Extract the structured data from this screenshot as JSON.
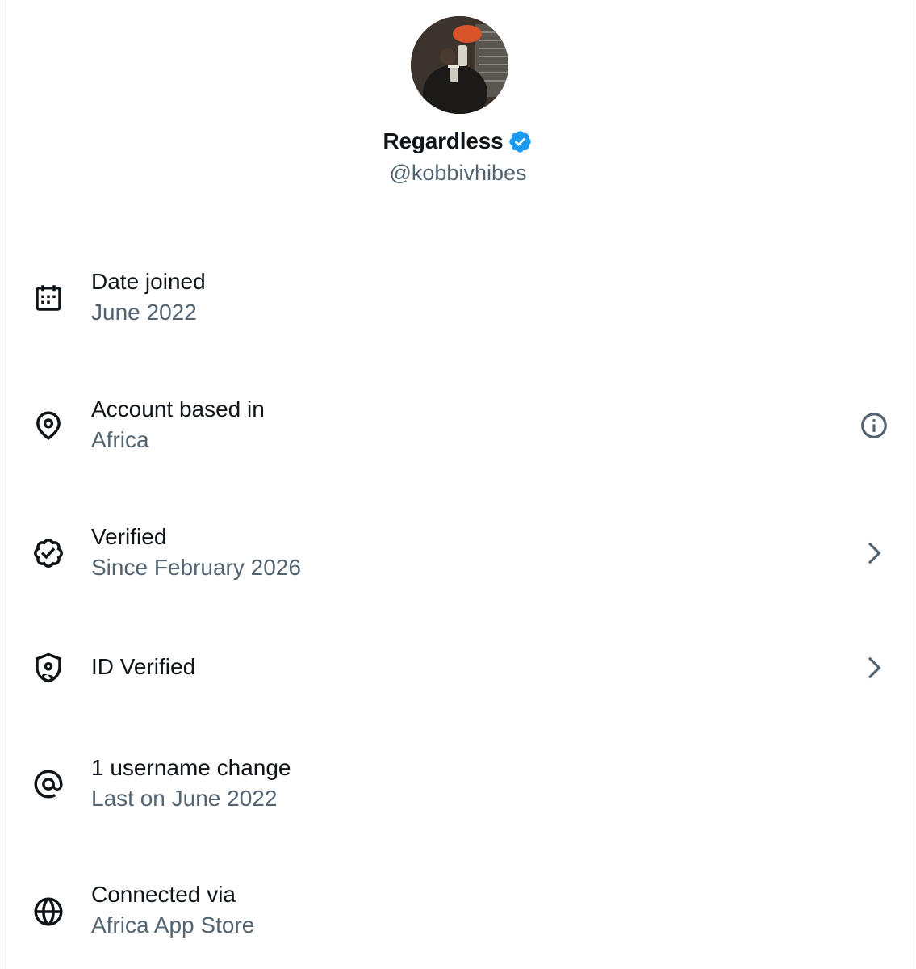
{
  "profile": {
    "display_name": "Regardless",
    "handle": "@kobbivhibes",
    "verified_color": "#1d9bf0"
  },
  "rows": [
    {
      "icon": "calendar-icon",
      "title": "Date joined",
      "value": "June 2022",
      "trailing": null
    },
    {
      "icon": "location-pin-icon",
      "title": "Account based in",
      "value": "Africa",
      "trailing": "info-icon"
    },
    {
      "icon": "verified-badge-icon",
      "title": "Verified",
      "value": "Since February 2026",
      "trailing": "chevron-right-icon"
    },
    {
      "icon": "id-shield-icon",
      "title": "ID Verified",
      "value": "",
      "trailing": "chevron-right-icon"
    },
    {
      "icon": "at-sign-icon",
      "title": "1 username change",
      "value": "Last on June 2022",
      "trailing": null
    },
    {
      "icon": "globe-icon",
      "title": "Connected via",
      "value": "Africa App Store",
      "trailing": null
    }
  ],
  "colors": {
    "primary_text": "#0f1419",
    "secondary_text": "#536471",
    "border": "#eff3f4"
  }
}
